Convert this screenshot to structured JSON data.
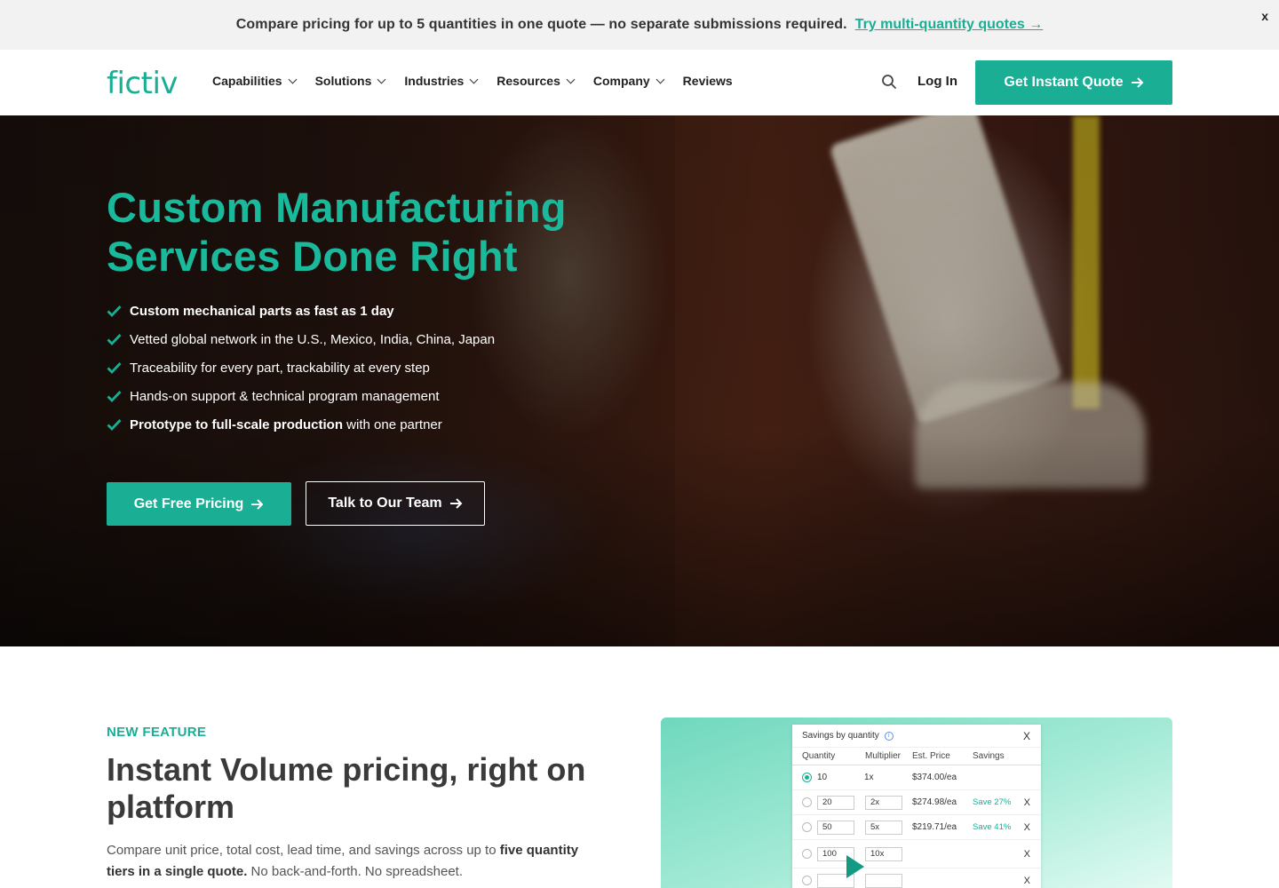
{
  "announcement": {
    "message": "Compare pricing for up to 5 quantities in one quote — no separate submissions required.",
    "link": "Try multi-quantity quotes →",
    "close": "x"
  },
  "header": {
    "logo": "fictiv",
    "nav": [
      "Capabilities",
      "Solutions",
      "Industries",
      "Resources",
      "Company",
      "Reviews"
    ],
    "login": "Log In",
    "cta": "Get Instant Quote"
  },
  "hero": {
    "title": "Custom Manufacturing Services Done Right",
    "bullets": [
      {
        "bold": "Custom mechanical parts as fast as 1 day",
        "rest": ""
      },
      {
        "bold": "",
        "rest": "Vetted global network in the U.S., Mexico, India, China, Japan"
      },
      {
        "bold": "",
        "rest": "Traceability for every part, trackability at every step"
      },
      {
        "bold": "",
        "rest": "Hands-on support & technical program management"
      },
      {
        "bold": "Prototype to full-scale production",
        "rest": " with one partner"
      }
    ],
    "primary_button": "Get Free Pricing",
    "secondary_button": "Talk to Our Team"
  },
  "feature": {
    "eyebrow": "NEW FEATURE",
    "title": "Instant Volume pricing, right on platform",
    "desc_start": "Compare unit price, total cost, lead time, and savings across up to ",
    "desc_bold": "five quantity tiers in a single quote.",
    "desc_end": " No back-and-forth. No spreadsheet."
  },
  "preview": {
    "title": "Savings by quantity",
    "close": "X",
    "columns": [
      "Quantity",
      "Multiplier",
      "Est. Price",
      "Savings"
    ],
    "rows": [
      {
        "qty": "10",
        "mult": "1x",
        "price": "$374.00/ea",
        "savings": "",
        "selected": true
      },
      {
        "qty": "20",
        "mult": "2x",
        "price": "$274.98/ea",
        "savings": "Save 27%",
        "selected": false
      },
      {
        "qty": "50",
        "mult": "5x",
        "price": "$219.71/ea",
        "savings": "Save 41%",
        "selected": false
      },
      {
        "qty": "100",
        "mult": "10x",
        "price": "",
        "savings": "",
        "selected": false
      },
      {
        "qty": "",
        "mult": "",
        "price": "",
        "savings": "",
        "selected": false
      }
    ]
  },
  "colors": {
    "accent": "#1aae94",
    "hero_title": "#1bb99b",
    "announcement_bg": "#f2f2f2"
  }
}
